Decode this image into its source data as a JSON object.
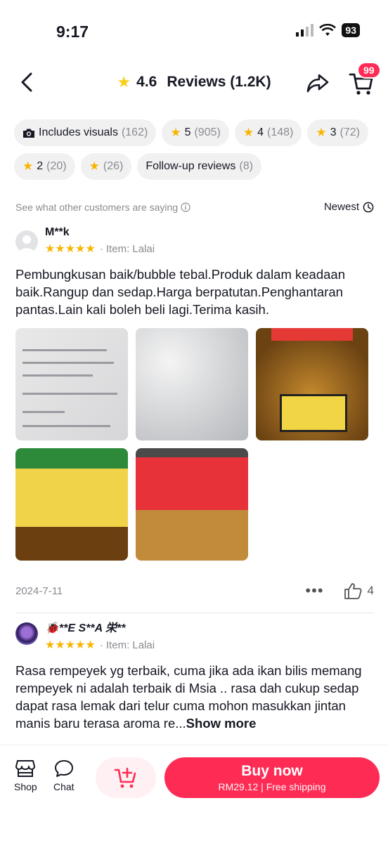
{
  "status": {
    "time": "9:17",
    "battery": "93"
  },
  "header": {
    "rating": "4.6",
    "title": "Reviews (1.2K)",
    "cart_count": "99"
  },
  "chips": [
    {
      "label": "Includes visuals",
      "count": "(162)",
      "icon": "camera-icon"
    },
    {
      "label": "5",
      "count": "(905)",
      "icon": "star-icon"
    },
    {
      "label": "4",
      "count": "(148)",
      "icon": "star-icon"
    },
    {
      "label": "3",
      "count": "(72)",
      "icon": "star-icon"
    },
    {
      "label": "2",
      "count": "(20)",
      "icon": "star-icon"
    },
    {
      "label": "",
      "count": "(26)",
      "icon": "star-icon"
    },
    {
      "label": "Follow-up reviews",
      "count": "(8)",
      "icon": ""
    }
  ],
  "caption": "See what other customers are saying",
  "sort_label": "Newest",
  "reviews": [
    {
      "name": "M**k",
      "stars": "★★★★★",
      "item": "Item: Lalai",
      "text": "Pembungkusan baik/bubble tebal.Produk dalam keadaan baik.Rangup dan sedap.Harga berpatutan.Penghantaran pantas.Lain kali boleh beli lagi.Terima kasih.",
      "date": "2024-7-11",
      "likes": "4"
    },
    {
      "name": "🐞**E S**A 栄**",
      "stars": "★★★★★",
      "item": "Item: Lalai",
      "text": "Rasa rempeyek yg terbaik, cuma jika ada ikan bilis memang rempeyek ni adalah terbaik di Msia .. rasa dah cukup sedap dapat rasa lemak dari telur cuma mohon masukkan jintan manis baru terasa aroma re...",
      "more": "Show more"
    }
  ],
  "bottom": {
    "shop": "Shop",
    "chat": "Chat",
    "buy_now": "Buy now",
    "price_line": "RM29.12 | Free shipping"
  },
  "colors": {
    "accent": "#FE2C55",
    "star": "#F8B500"
  }
}
